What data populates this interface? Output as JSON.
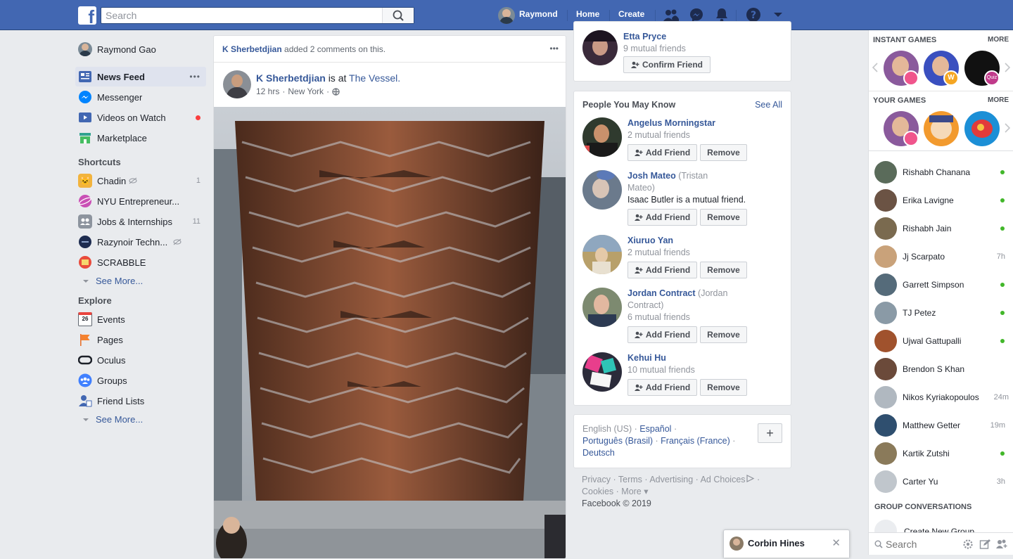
{
  "topbar": {
    "logo": "f",
    "search_placeholder": "Search",
    "user_name": "Raymond",
    "home": "Home",
    "create": "Create",
    "icons": [
      "friends-icon",
      "messenger-icon",
      "notifications-icon",
      "help-icon",
      "dropdown-icon"
    ]
  },
  "leftnav": {
    "profile_name": "Raymond Gao",
    "main": [
      {
        "label": "News Feed",
        "more": "•••"
      },
      {
        "label": "Messenger"
      },
      {
        "label": "Videos on Watch"
      },
      {
        "label": "Marketplace"
      }
    ],
    "shortcuts_heading": "Shortcuts",
    "shortcuts": [
      {
        "label": "Chadin",
        "count": "1"
      },
      {
        "label": "NYU Entrepreneur...",
        "count": ""
      },
      {
        "label": "Jobs & Internships",
        "count": "11"
      },
      {
        "label": "Razynoir Techn...",
        "count": ""
      },
      {
        "label": "SCRABBLE",
        "count": ""
      }
    ],
    "see_more": "See More...",
    "explore_heading": "Explore",
    "explore": [
      {
        "label": "Events",
        "icon_text": "26"
      },
      {
        "label": "Pages"
      },
      {
        "label": "Oculus"
      },
      {
        "label": "Groups"
      },
      {
        "label": "Friend Lists"
      }
    ],
    "see_more_2": "See More..."
  },
  "post": {
    "activity_actor": "K Sherbetdjian",
    "activity_text": "added 2 comments on this.",
    "author": "K Sherbetdjian",
    "is_at": "is at",
    "place": "The Vessel.",
    "time": "12 hrs",
    "location": "New York",
    "menu": "•••"
  },
  "friend_request": {
    "name": "Etta Pryce",
    "mutual": "9 mutual friends",
    "confirm": "Confirm Friend"
  },
  "pymk": {
    "title": "People You May Know",
    "see_all": "See All",
    "add_label": "Add Friend",
    "remove_label": "Remove",
    "people": [
      {
        "name": "Angelus Morningstar",
        "extra": "",
        "line2": "",
        "mutual": "2 mutual friends"
      },
      {
        "name": "Josh Mateo",
        "extra": "(Tristan",
        "line2": "Mateo)",
        "mutual": "Isaac Butler is a mutual friend."
      },
      {
        "name": "Xiuruo Yan",
        "extra": "",
        "line2": "",
        "mutual": "2 mutual friends"
      },
      {
        "name": "Jordan Contract",
        "extra": "(Jordan",
        "line2": "Contract)",
        "mutual": "6 mutual friends"
      },
      {
        "name": "Kehui Hu",
        "extra": "",
        "line2": "",
        "mutual": "10 mutual friends"
      }
    ]
  },
  "languages": {
    "current": "English (US)",
    "others": [
      "Español",
      "Português (Brasil)",
      "Français (France)",
      "Deutsch"
    ],
    "add": "+"
  },
  "footer": {
    "links": [
      "Privacy",
      "Terms",
      "Advertising",
      "Ad Choices",
      "Cookies",
      "More"
    ],
    "copyright": "Facebook © 2019"
  },
  "games": {
    "instant_heading": "INSTANT GAMES",
    "more": "MORE",
    "your_heading": "YOUR GAMES",
    "badge_w": "W",
    "badge_quiz": "Quiz"
  },
  "contacts": [
    {
      "name": "Rishabh Chanana",
      "status": "",
      "online": true,
      "color": "#5a6b5a"
    },
    {
      "name": "Erika Lavigne",
      "status": "",
      "online": true,
      "color": "#6b5344"
    },
    {
      "name": "Rishabh Jain",
      "status": "",
      "online": true,
      "color": "#7a6a4f"
    },
    {
      "name": "Jj Scarpato",
      "status": "7h",
      "online": false,
      "color": "#c9a27a"
    },
    {
      "name": "Garrett Simpson",
      "status": "",
      "online": true,
      "color": "#556b7a"
    },
    {
      "name": "TJ Petez",
      "status": "",
      "online": true,
      "color": "#8a9aa6"
    },
    {
      "name": "Ujwal Gattupalli",
      "status": "",
      "online": true,
      "color": "#a0522d"
    },
    {
      "name": "Brendon S Khan",
      "status": "",
      "online": false,
      "color": "#6b4a3a"
    },
    {
      "name": "Nikos Kyriakopoulos",
      "status": "24m",
      "online": false,
      "color": "#b0b8c0"
    },
    {
      "name": "Matthew Getter",
      "status": "19m",
      "online": false,
      "color": "#2f4f6f"
    },
    {
      "name": "Kartik Zutshi",
      "status": "",
      "online": true,
      "color": "#8a7a5a"
    },
    {
      "name": "Carter Yu",
      "status": "3h",
      "online": false,
      "color": "#c0c6cc"
    }
  ],
  "group_conv": {
    "heading": "GROUP CONVERSATIONS",
    "create": "Create New Group"
  },
  "chat_search": {
    "placeholder": "Search"
  },
  "chat_tab": {
    "name": "Corbin Hines",
    "close": "✕"
  }
}
